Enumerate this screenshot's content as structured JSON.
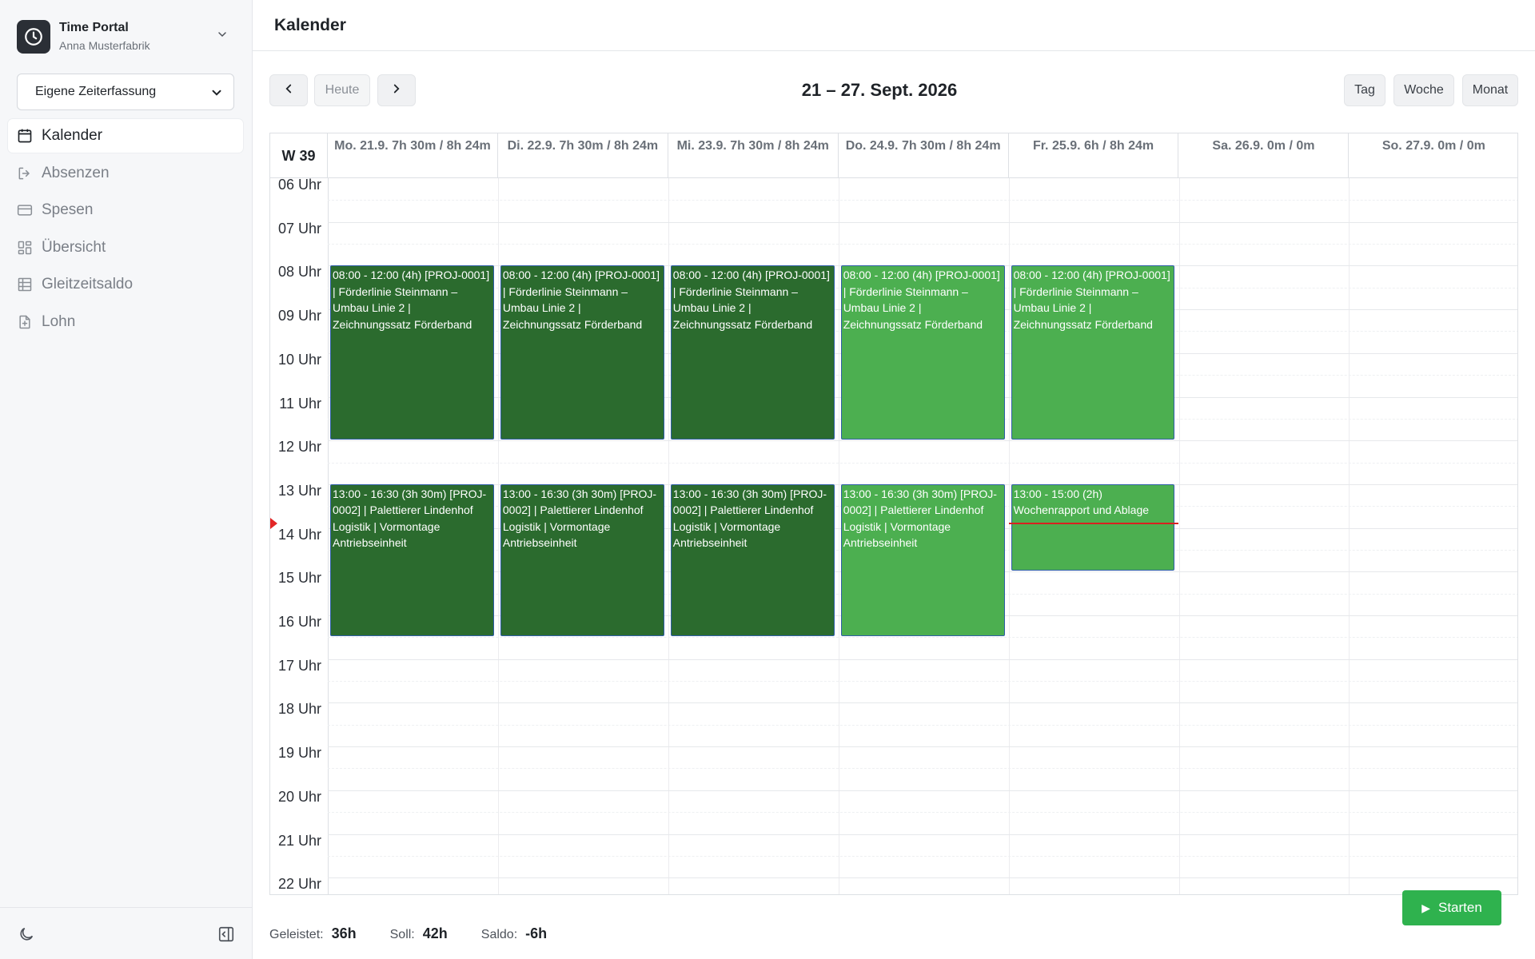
{
  "app": {
    "title": "Time Portal",
    "user": "Anna Musterfabrik"
  },
  "scope_select": {
    "value": "Eigene Zeiterfassung"
  },
  "nav": [
    {
      "label": "Kalender",
      "icon": "calendar-icon",
      "active": true
    },
    {
      "label": "Absenzen",
      "icon": "logout-icon",
      "active": false
    },
    {
      "label": "Spesen",
      "icon": "credit-card-icon",
      "active": false
    },
    {
      "label": "Übersicht",
      "icon": "dashboard-grid-icon",
      "active": false
    },
    {
      "label": "Gleitzeitsaldo",
      "icon": "table-icon",
      "active": false
    },
    {
      "label": "Lohn",
      "icon": "document-icon",
      "active": false
    }
  ],
  "page": {
    "title": "Kalender"
  },
  "toolbar": {
    "today_label": "Heute",
    "range_label": "21 – 27. Sept. 2026",
    "views": [
      "Tag",
      "Woche",
      "Monat"
    ]
  },
  "calendar": {
    "week_label": "W 39",
    "days": [
      {
        "label": "Mo. 21.9. 7h 30m / 8h 24m"
      },
      {
        "label": "Di. 22.9. 7h 30m / 8h 24m"
      },
      {
        "label": "Mi. 23.9. 7h 30m / 8h 24m"
      },
      {
        "label": "Do. 24.9. 7h 30m / 8h 24m"
      },
      {
        "label": "Fr. 25.9. 6h / 8h 24m"
      },
      {
        "label": "Sa. 26.9. 0m / 0m"
      },
      {
        "label": "So. 27.9. 0m / 0m"
      }
    ],
    "hours": [
      "06 Uhr",
      "07 Uhr",
      "08 Uhr",
      "09 Uhr",
      "10 Uhr",
      "11 Uhr",
      "12 Uhr",
      "13 Uhr",
      "14 Uhr",
      "15 Uhr",
      "16 Uhr",
      "17 Uhr",
      "18 Uhr",
      "19 Uhr",
      "20 Uhr",
      "21 Uhr",
      "22 Uhr"
    ],
    "events": [
      {
        "day": 0,
        "start": 8,
        "end": 12,
        "shade": "dark",
        "text": "08:00 - 12:00 (4h) [PROJ-0001] | Förderlinie Steinmann – Umbau Linie 2 | Zeichnungssatz Förderband"
      },
      {
        "day": 1,
        "start": 8,
        "end": 12,
        "shade": "dark",
        "text": "08:00 - 12:00 (4h) [PROJ-0001] | Förderlinie Steinmann – Umbau Linie 2 | Zeichnungssatz Förderband"
      },
      {
        "day": 2,
        "start": 8,
        "end": 12,
        "shade": "dark",
        "text": "08:00 - 12:00 (4h) [PROJ-0001] | Förderlinie Steinmann – Umbau Linie 2 | Zeichnungssatz Förderband"
      },
      {
        "day": 3,
        "start": 8,
        "end": 12,
        "shade": "light",
        "text": "08:00 - 12:00 (4h) [PROJ-0001] | Förderlinie Steinmann – Umbau Linie 2 | Zeichnungssatz Förderband"
      },
      {
        "day": 4,
        "start": 8,
        "end": 12,
        "shade": "light",
        "text": "08:00 - 12:00 (4h) [PROJ-0001] | Förderlinie Steinmann – Umbau Linie 2 | Zeichnungssatz Förderband"
      },
      {
        "day": 0,
        "start": 13,
        "end": 16.5,
        "shade": "dark",
        "text": "13:00 - 16:30 (3h 30m) [PROJ-0002] | Palettierer Lindenhof Logistik | Vormontage Antriebseinheit"
      },
      {
        "day": 1,
        "start": 13,
        "end": 16.5,
        "shade": "dark",
        "text": "13:00 - 16:30 (3h 30m) [PROJ-0002] | Palettierer Lindenhof Logistik | Vormontage Antriebseinheit"
      },
      {
        "day": 2,
        "start": 13,
        "end": 16.5,
        "shade": "dark",
        "text": "13:00 - 16:30 (3h 30m) [PROJ-0002] | Palettierer Lindenhof Logistik | Vormontage Antriebseinheit"
      },
      {
        "day": 3,
        "start": 13,
        "end": 16.5,
        "shade": "light",
        "text": "13:00 - 16:30 (3h 30m) [PROJ-0002] | Palettierer Lindenhof Logistik | Vormontage Antriebseinheit"
      },
      {
        "day": 4,
        "start": 13,
        "end": 15,
        "shade": "light",
        "text": "13:00 - 15:00 (2h) Wochenrapport und Ablage"
      }
    ],
    "now": {
      "day": 4,
      "time": 13.9
    }
  },
  "totals": {
    "worked_label": "Geleistet:",
    "worked_value": "36h",
    "target_label": "Soll:",
    "target_value": "42h",
    "balance_label": "Saldo:",
    "balance_value": "-6h"
  },
  "start_button": {
    "label": "Starten"
  },
  "colors": {
    "event_dark": "#2b6b2e",
    "event_light": "#4caf50",
    "start_button": "#2fb24e",
    "now_line": "#d92020"
  }
}
